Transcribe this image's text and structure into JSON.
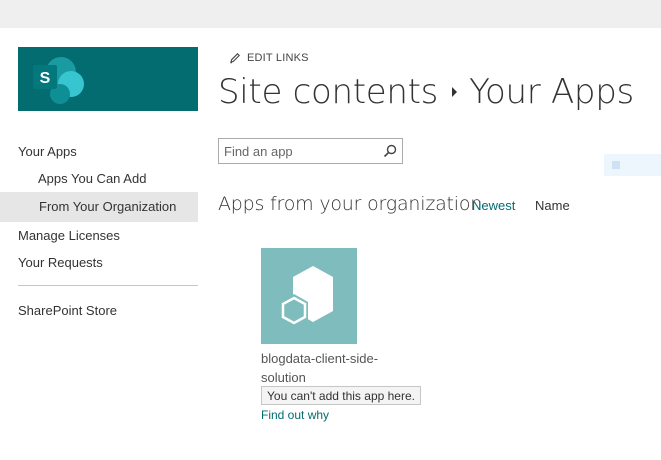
{
  "colors": {
    "brand": "#036c70",
    "tile": "#7fbcbd",
    "selected_bg": "#e6e6e6"
  },
  "header": {
    "logo_icon": "sharepoint-logo",
    "edit_links_label": "EDIT LINKS",
    "edit_icon": "pencil-icon",
    "breadcrumb_root": "Site contents",
    "breadcrumb_current": "Your Apps"
  },
  "search": {
    "placeholder": "Find an app",
    "value": "",
    "icon": "search-icon"
  },
  "nav": {
    "your_apps": "Your Apps",
    "apps_you_can_add": "Apps You Can Add",
    "from_your_organization": "From Your Organization",
    "manage_licenses": "Manage Licenses",
    "your_requests": "Your Requests",
    "sharepoint_store": "SharePoint Store"
  },
  "main": {
    "section_title": "Apps from your organization",
    "sort_newest": "Newest",
    "sort_name": "Name",
    "apps": [
      {
        "name": "blogdata-client-side-solution",
        "icon": "app-cubes-icon",
        "status": "You can't add this app here.",
        "help_link": "Find out why"
      }
    ]
  }
}
